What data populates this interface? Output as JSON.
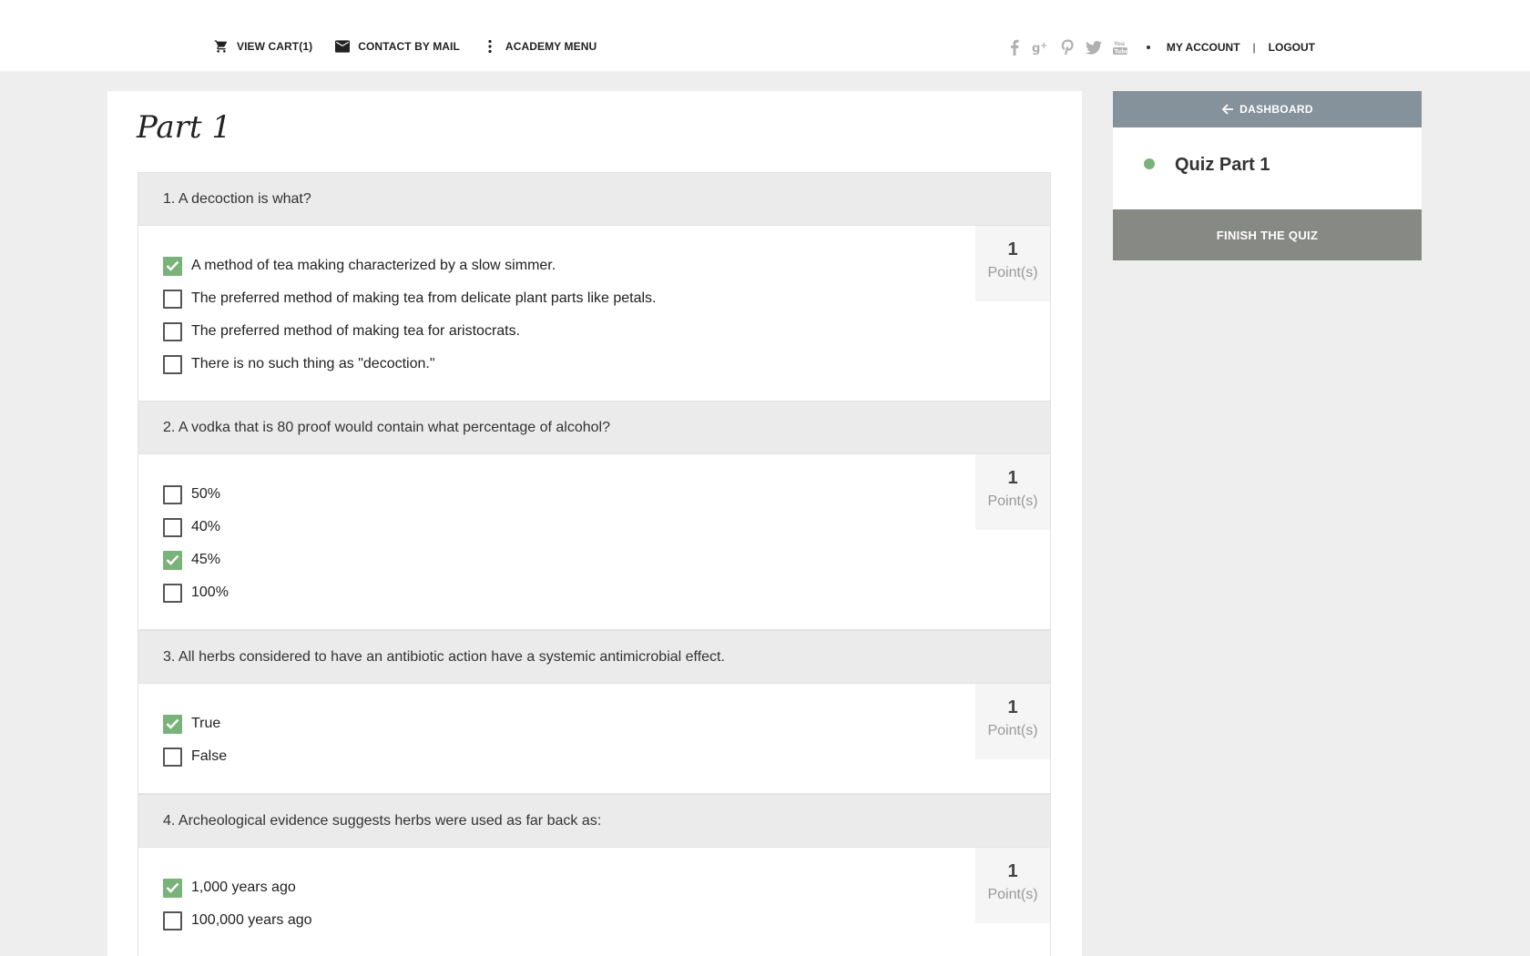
{
  "nav": {
    "cart": {
      "label": "VIEW CART(1)",
      "icon": "cart-icon"
    },
    "contact": {
      "label": "CONTACT BY MAIL",
      "icon": "mail-icon"
    },
    "academy": {
      "label": "ACADEMY MENU",
      "icon": "more-vertical-icon"
    }
  },
  "social": [
    "facebook-icon",
    "google-plus-icon",
    "pinterest-icon",
    "twitter-icon",
    "youtube-icon"
  ],
  "account": {
    "my_account": "MY ACCOUNT",
    "separator": "|",
    "logout": "LOGOUT"
  },
  "page": {
    "title": "Part 1"
  },
  "questions": [
    {
      "text": "1. A decoction is what?",
      "points": "1",
      "points_label": "Point(s)",
      "answers": [
        {
          "text": "A method of tea making characterized by a slow simmer.",
          "checked": true
        },
        {
          "text": "The preferred method of making tea from delicate plant parts like petals.",
          "checked": false
        },
        {
          "text": "The preferred method of making tea for aristocrats.",
          "checked": false
        },
        {
          "text": "There is no such thing as \"decoction.\"",
          "checked": false
        }
      ]
    },
    {
      "text": "2. A vodka that is 80 proof would contain what percentage of alcohol?",
      "points": "1",
      "points_label": "Point(s)",
      "answers": [
        {
          "text": "50%",
          "checked": false
        },
        {
          "text": "40%",
          "checked": false
        },
        {
          "text": "45%",
          "checked": true
        },
        {
          "text": "100%",
          "checked": false
        }
      ]
    },
    {
      "text": "3. All herbs considered to have an antibiotic action have a systemic antimicrobial effect.",
      "points": "1",
      "points_label": "Point(s)",
      "answers": [
        {
          "text": "True",
          "checked": true
        },
        {
          "text": "False",
          "checked": false
        }
      ]
    },
    {
      "text": "4. Archeological evidence suggests herbs were used as far back as:",
      "points": "1",
      "points_label": "Point(s)",
      "answers": [
        {
          "text": "1,000 years ago",
          "checked": true
        },
        {
          "text": "100,000 years ago",
          "checked": false
        }
      ]
    }
  ],
  "sidebar": {
    "dashboard": "DASHBOARD",
    "quiz_name": "Quiz Part 1",
    "finish": "FINISH THE QUIZ"
  },
  "colors": {
    "accent_green": "#7ab37a",
    "dashboard_bg": "#85919b",
    "finish_bg": "#878985"
  }
}
